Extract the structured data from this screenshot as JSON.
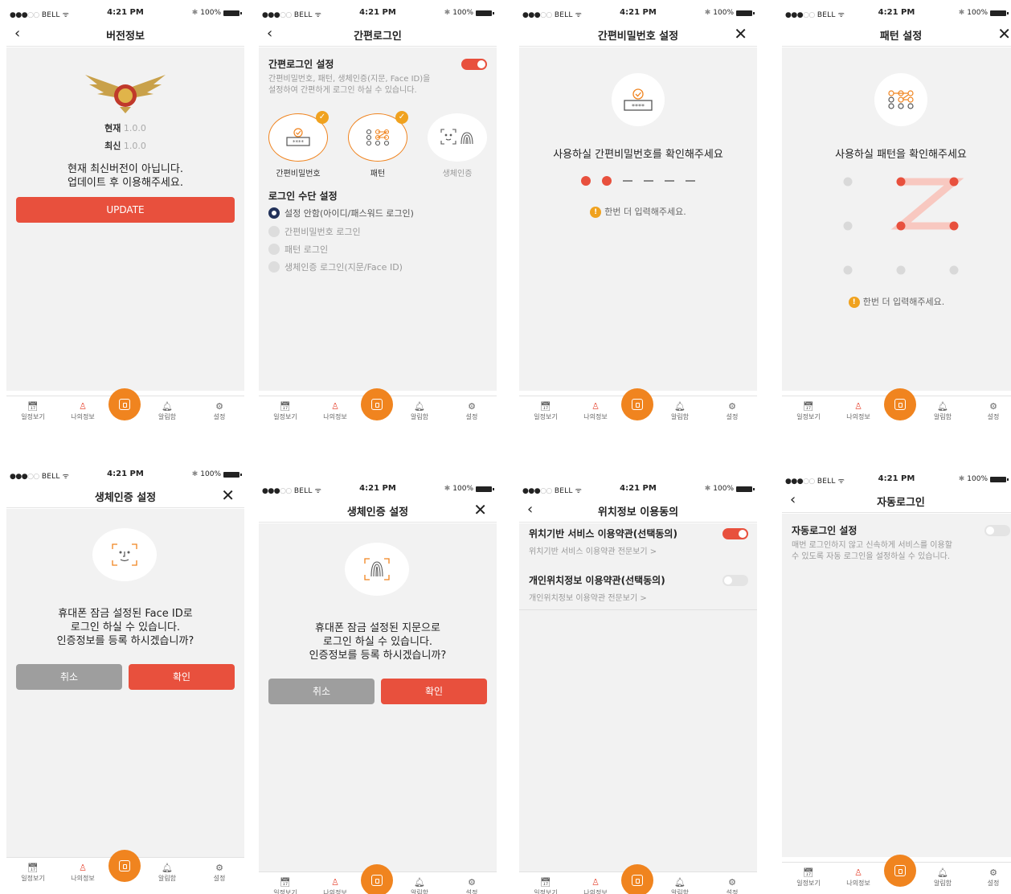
{
  "status": {
    "carrier": "BELL",
    "time": "4:21 PM",
    "battery": "100%"
  },
  "tabs": {
    "schedule": "일정보기",
    "myinfo": "나의정보",
    "alarm": "알림함",
    "settings": "설정"
  },
  "colors": {
    "accent": "#e8503d",
    "home": "#f0841f",
    "radio_selected": "#22325a"
  },
  "icons": {
    "back": "chevron-left-icon",
    "close": "close-icon",
    "home": "home-icon",
    "schedule": "calendar-icon",
    "myinfo": "person-icon",
    "alarm": "bell-icon",
    "settings": "gear-icon"
  },
  "version": {
    "title": "버전정보",
    "current_label": "현재",
    "current_value": "1.0.0",
    "latest_label": "최신",
    "latest_value": "1.0.0",
    "message_line1": "현재 최신버전이 아닙니다.",
    "message_line2": "업데이트 후 이용해주세요.",
    "update_button": "UPDATE"
  },
  "easylogin": {
    "title": "간편로그인",
    "setting_title": "간편로그인 설정",
    "setting_desc_line1": "간편비밀번호, 패턴, 생체인증(지문, Face ID)을",
    "setting_desc_line2": "설정하여 간편하게 로그인 하실 수 있습니다.",
    "setting_toggle": true,
    "options": [
      {
        "label": "간편비밀번호",
        "checked": true
      },
      {
        "label": "패턴",
        "checked": true
      },
      {
        "label": "생체인증",
        "checked": false
      }
    ],
    "method_title": "로그인 수단 설정",
    "methods": [
      {
        "label": "설정 안함(아이디/패스워드 로그인)",
        "selected": true
      },
      {
        "label": "간편비밀번호 로그인",
        "selected": false
      },
      {
        "label": "패턴 로그인",
        "selected": false
      },
      {
        "label": "생체인증 로그인(지문/Face ID)",
        "selected": false
      }
    ]
  },
  "pin": {
    "title": "간편비밀번호 설정",
    "prompt": "사용하실 간편비밀번호를 확인해주세요",
    "entered": 2,
    "total": 6,
    "hint_mark": "!",
    "hint": "한번 더 입력해주세요."
  },
  "pattern": {
    "title": "패턴 설정",
    "prompt": "사용하실 패턴을 확인해주세요",
    "path": [
      1,
      2,
      3,
      4,
      5
    ],
    "hint_mark": "!",
    "hint": "한번 더 입력해주세요."
  },
  "faceid": {
    "title": "생체인증 설정",
    "line1": "휴대폰 잠금 설정된 Face ID로",
    "line2": "로그인 하실 수 있습니다.",
    "line3": "인증정보를 등록 하시겠습니까?",
    "cancel": "취소",
    "confirm": "확인"
  },
  "fingerprint": {
    "title": "생체인증 설정",
    "line1": "휴대폰 잠금 설정된 지문으로",
    "line2": "로그인 하실 수 있습니다.",
    "line3": "인증정보를 등록 하시겠습니까?",
    "cancel": "취소",
    "confirm": "확인"
  },
  "location": {
    "title": "위치정보 이용동의",
    "items": [
      {
        "title": "위치기반 서비스 이용약관(선택동의)",
        "link": "위치기반 서비스 이용약관 전문보기 >",
        "on": true
      },
      {
        "title": "개인위치정보 이용약관(선택동의)",
        "link": "개인위치정보 이용약관 전문보기 >",
        "on": false
      }
    ]
  },
  "autologin": {
    "title": "자동로그인",
    "setting_title": "자동로그인 설정",
    "desc_line1": "매번 로그인하지 않고 신속하게 서비스를 이용할",
    "desc_line2": "수 있도록 자동 로그인을 설정하실 수 있습니다.",
    "on": false
  }
}
